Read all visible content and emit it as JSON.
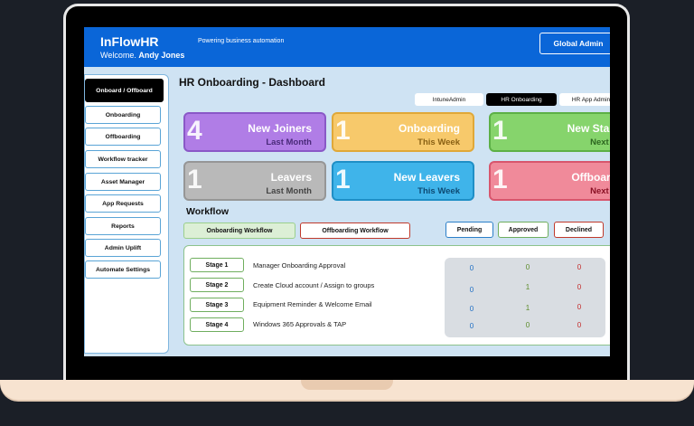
{
  "app": {
    "brand": "InFlowHR",
    "welcome_prefix": "Welcome.",
    "user_name": "Andy Jones",
    "tagline": "Powering business automation",
    "admin_button": "Global Admin"
  },
  "sidebar": {
    "items": [
      {
        "label": "Onboard / Offboard"
      },
      {
        "label": "Onboarding"
      },
      {
        "label": "Offboarding"
      },
      {
        "label": "Workflow tracker"
      },
      {
        "label": "Asset Manager"
      },
      {
        "label": "App Requests"
      },
      {
        "label": "Reports"
      },
      {
        "label": "Admin Uplift"
      },
      {
        "label": "Automate Settings"
      }
    ]
  },
  "main": {
    "title": "HR Onboarding - Dashboard",
    "tabs": [
      {
        "label": "IntuneAdmin"
      },
      {
        "label": "HR Onboarding"
      },
      {
        "label": "HR App Admin"
      }
    ]
  },
  "cards": [
    {
      "number": "4",
      "title": "New Joiners",
      "period": "Last Month",
      "bg": "#b07de6",
      "border": "#8a58c7",
      "period_color": "#4a2a7a"
    },
    {
      "number": "1",
      "title": "Onboarding",
      "period": "This Week",
      "bg": "#f7c96b",
      "border": "#e0a838",
      "period_color": "#8a6114"
    },
    {
      "number": "1",
      "title": "New Starters",
      "period": "Next Week",
      "bg": "#86d46c",
      "border": "#5cb046",
      "period_color": "#2d6620"
    },
    {
      "number": "1",
      "title": "Leavers",
      "period": "Last Month",
      "bg": "#b9b9b9",
      "border": "#969696",
      "period_color": "#444444"
    },
    {
      "number": "1",
      "title": "New Leavers",
      "period": "This Week",
      "bg": "#3fb4ea",
      "border": "#1f8fc6",
      "period_color": "#0d4a73"
    },
    {
      "number": "1",
      "title": "Offboarding",
      "period": "Next Week",
      "bg": "#f08a9a",
      "border": "#d8566d",
      "period_color": "#8a1024"
    }
  ],
  "workflow": {
    "title": "Workflow",
    "onboarding_btn": "Onboarding Workflow",
    "offboarding_btn": "Offboarding Workflow",
    "status": {
      "pending": "Pending",
      "approved": "Approved",
      "declined": "Declined"
    },
    "stages": [
      {
        "label": "Stage 1",
        "description": "Manager Onboarding Approval",
        "pending": "0",
        "approved": "0",
        "declined": "0"
      },
      {
        "label": "Stage 2",
        "description": "Create Cloud account / Assign to groups",
        "pending": "0",
        "approved": "1",
        "declined": "0"
      },
      {
        "label": "Stage 3",
        "description": "Equipment Reminder & Welcome Email",
        "pending": "0",
        "approved": "1",
        "declined": "0"
      },
      {
        "label": "Stage 4",
        "description": "Windows 365 Approvals & TAP",
        "pending": "0",
        "approved": "0",
        "declined": "0"
      }
    ]
  },
  "colors": {
    "topbar": "#0a66d8",
    "screen_bg": "#cfe3f3",
    "pending": "#1f6fc4",
    "approved": "#5c8c2a",
    "declined": "#c42a2a"
  }
}
